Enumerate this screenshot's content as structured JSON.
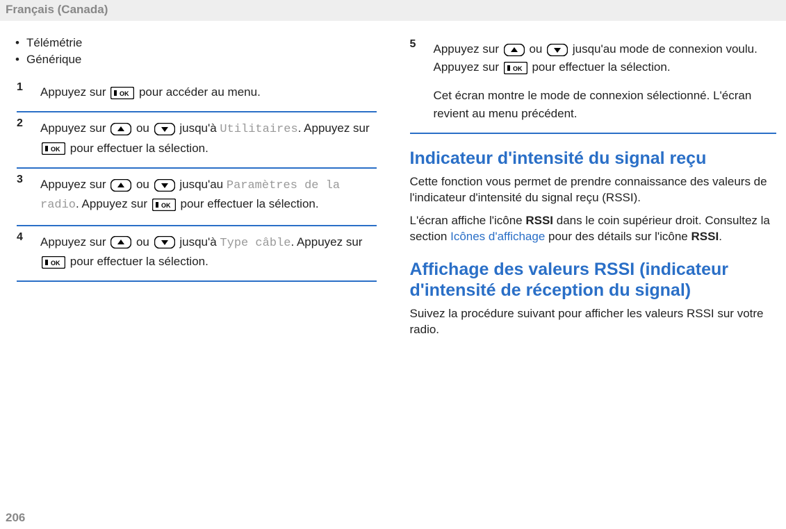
{
  "header": "Français (Canada)",
  "pageNumber": "206",
  "bullets": [
    "Télémétrie",
    "Générique"
  ],
  "commonText": {
    "appuyezSur": "Appuyez sur ",
    "ou": " ou ",
    "pourAcceder": " pour accéder au menu.",
    "jusqua": " jusqu'à ",
    "jusquAu": " jusqu'au ",
    "pourEffectuer": " pour effectuer la sélection.",
    "dot": ". "
  },
  "steps": [
    {
      "num": "1"
    },
    {
      "num": "2",
      "menu": "Utilitaires"
    },
    {
      "num": "3",
      "menu": "Paramètres de la radio"
    },
    {
      "num": "4",
      "menu": "Type câble"
    },
    {
      "num": "5",
      "textA": " jusqu'au mode de connexion voulu. Appuyez sur ",
      "textB": " pour effectuer la sélection.",
      "note": "Cet écran montre le mode de connexion sélectionné. L'écran revient au menu précédent."
    }
  ],
  "section1": {
    "title": "Indicateur d'intensité du signal reçu",
    "p1": "Cette fonction vous permet de prendre connaissance des valeurs de l'indicateur d'intensité du signal reçu (RSSI).",
    "p2a": "L'écran affiche l'icône ",
    "p2bold1": "RSSI",
    "p2b": " dans le coin supérieur droit. Consultez la section ",
    "p2link": "Icônes d'affichage",
    "p2c": " pour des détails sur l'icône ",
    "p2bold2": "RSSI",
    "p2d": "."
  },
  "section2": {
    "title": "Affichage des valeurs RSSI (indicateur d'intensité de réception du signal)",
    "p1": "Suivez la procédure suivant pour afficher les valeurs RSSI sur votre radio."
  }
}
